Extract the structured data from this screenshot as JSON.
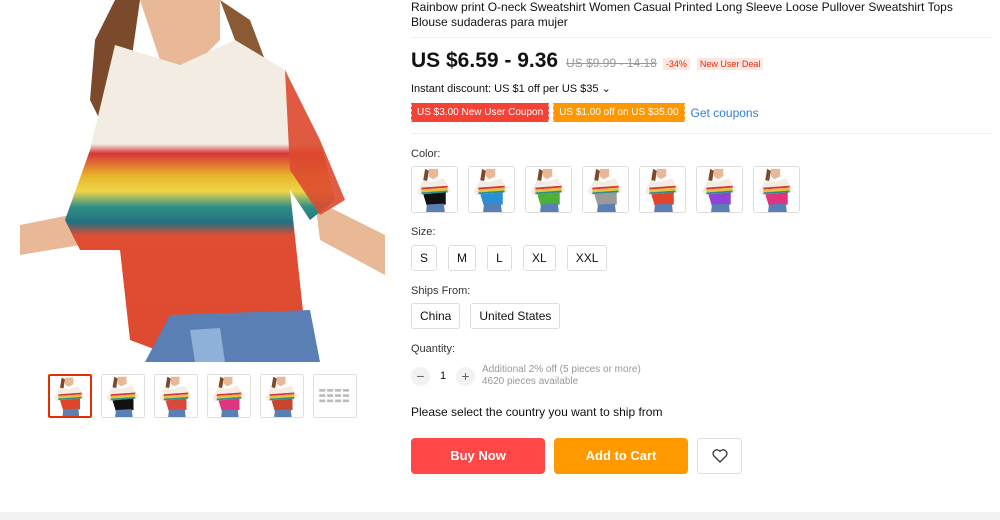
{
  "product": {
    "title": "Rainbow print O-neck Sweatshirt Women Casual Printed Long Sleeve Loose Pullover Sweatshirt Tops Blouse sudaderas para mujer",
    "price": "US $6.59 - 9.36",
    "original_price": "US $9.99 - 14.18",
    "discount": "-34%",
    "deal_badge": "New User Deal",
    "instant_discount": "Instant discount: US $1 off per US $35 ⌄"
  },
  "coupons": {
    "items": [
      "US $3.00 New User Coupon",
      "US $1.00 off on US $35.00"
    ],
    "get_label": "Get coupons"
  },
  "color": {
    "label": "Color:",
    "swatches": [
      "black",
      "blue",
      "green",
      "gray",
      "orange",
      "purple",
      "pink"
    ],
    "swatch_colors": [
      "#111111",
      "#2a8fd4",
      "#4caf3a",
      "#9a9a9a",
      "#e0452a",
      "#8e44d6",
      "#e0357e"
    ]
  },
  "size": {
    "label": "Size:",
    "options": [
      "S",
      "M",
      "L",
      "XL",
      "XXL"
    ]
  },
  "ships_from": {
    "label": "Ships From:",
    "options": [
      "China",
      "United States"
    ]
  },
  "quantity": {
    "label": "Quantity:",
    "value": "1",
    "minus": "−",
    "plus": "+",
    "note_line1": "Additional 2% off (5 pieces or more)",
    "note_line2": "4620 pieces available"
  },
  "shipping_notice": "Please select the country you want to ship from",
  "actions": {
    "buy": "Buy Now",
    "cart": "Add to Cart",
    "wishlist_icon": "heart-icon"
  },
  "thumbnails": {
    "count": 6,
    "colors": [
      "#e0452a",
      "#111111",
      "#d9483a",
      "#e0357e",
      "#c8452f",
      "#bbbbbb"
    ]
  }
}
